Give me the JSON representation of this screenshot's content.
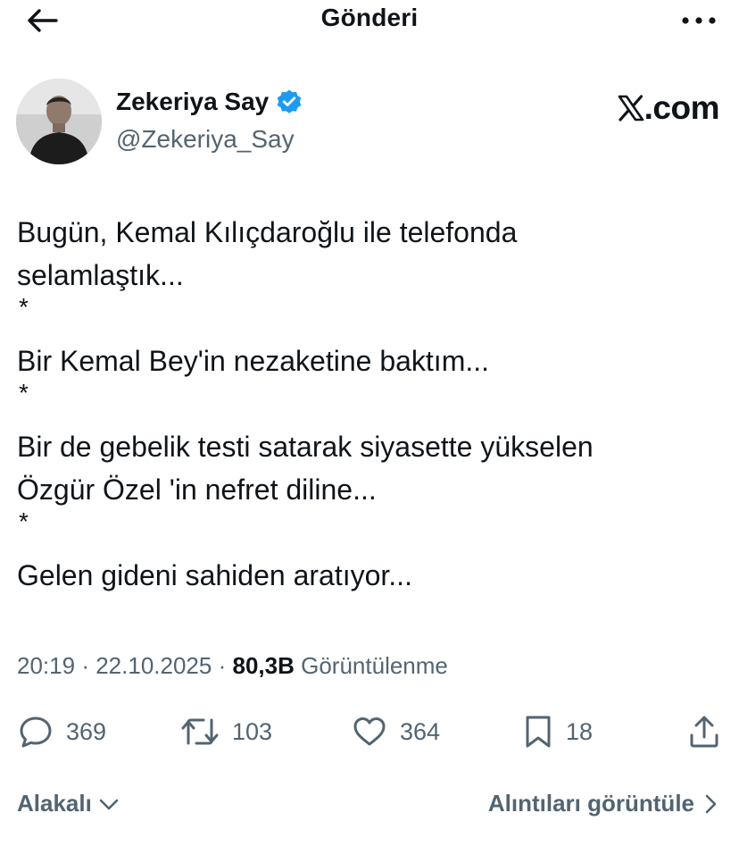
{
  "header": {
    "title": "Gönderi",
    "back_icon": "arrow-left-icon",
    "more_icon": "more-horizontal-icon"
  },
  "author": {
    "name": "Zekeriya Say",
    "handle": "@Zekeriya_Say",
    "verified": true,
    "verified_color": "#1d9bf0"
  },
  "brand": {
    "label": ".com",
    "logo_icon": "x-logo-icon"
  },
  "tweet": {
    "lines": [
      "Bugün, Kemal Kılıçdaroğlu ile telefonda",
      "selamlaştık...",
      "*",
      "Bir Kemal Bey'in nezaketine baktım...",
      "*",
      "Bir de gebelik testi satarak siyasette yükselen",
      "Özgür Özel 'in nefret diline...",
      "*",
      "Gelen gideni sahiden aratıyor..."
    ]
  },
  "meta": {
    "time": "20:19",
    "separator": "·",
    "date": "22.10.2025",
    "views_count": "80,3B",
    "views_label": "Görüntülenme"
  },
  "actions": {
    "reply_count": "369",
    "retweet_count": "103",
    "like_count": "364",
    "bookmark_count": "18"
  },
  "footer": {
    "relevant_label": "Alakalı",
    "quotes_label": "Alıntıları görüntüle"
  },
  "colors": {
    "text": "#0f1419",
    "secondary": "#536471",
    "background": "#ffffff"
  }
}
